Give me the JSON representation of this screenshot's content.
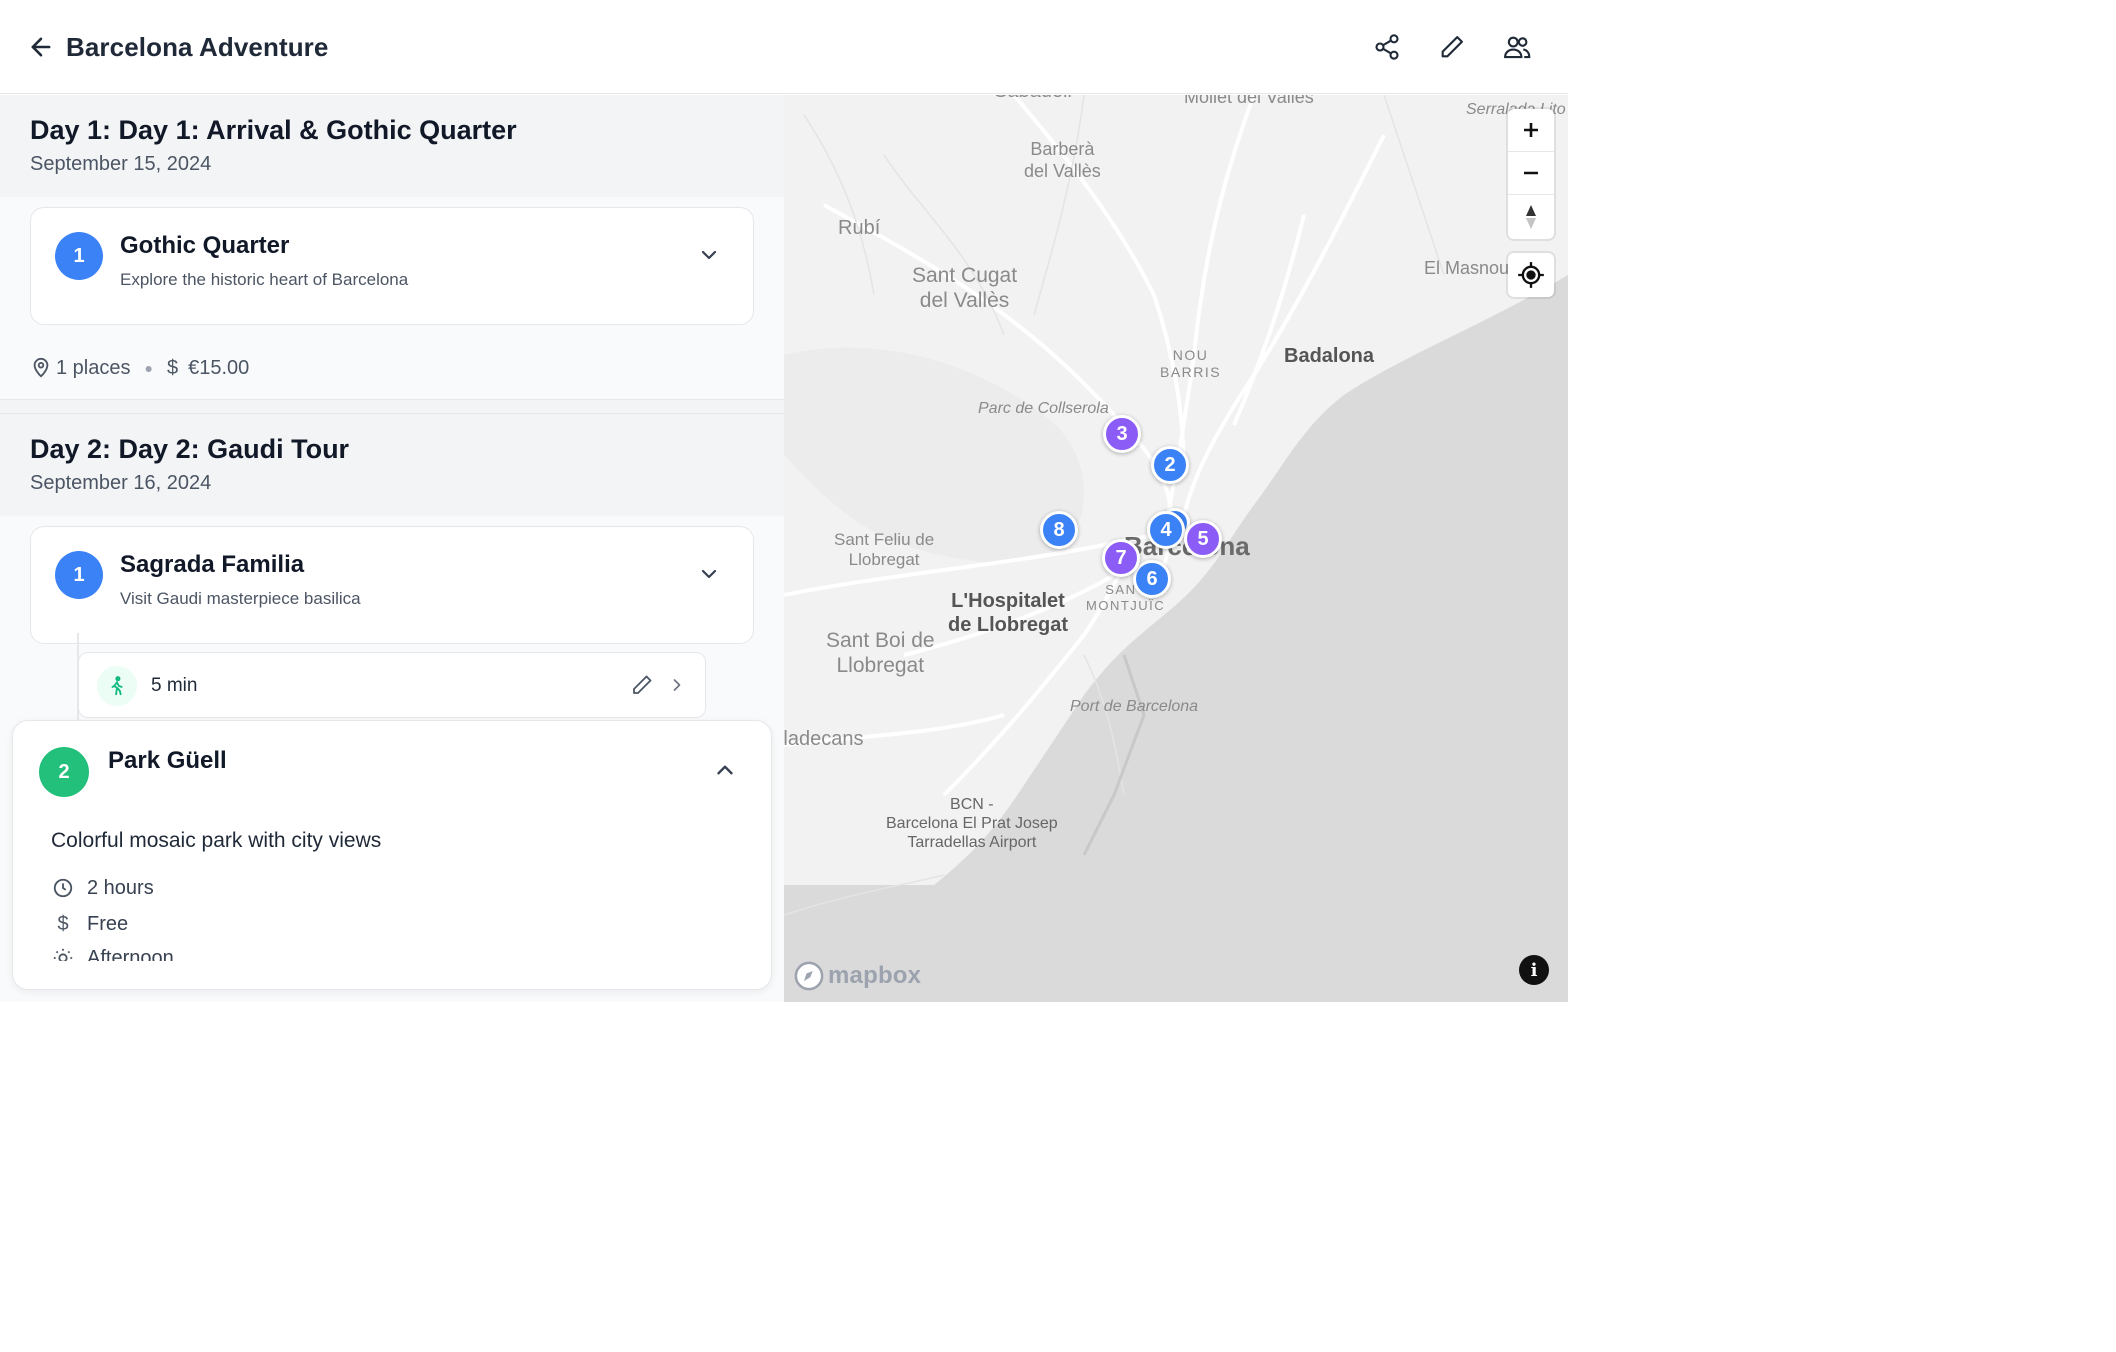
{
  "header": {
    "title": "Barcelona Adventure",
    "share_icon": "share-icon",
    "edit_icon": "pencil-icon",
    "collaborators_icon": "users-icon"
  },
  "days": [
    {
      "title": "Day 1: Day 1: Arrival & Gothic Quarter",
      "date": "September 15, 2024",
      "places": [
        {
          "number": "1",
          "name": "Gothic Quarter",
          "description": "Explore the historic heart of Barcelona"
        }
      ],
      "stats": {
        "places": "1 places",
        "cost": "€15.00"
      }
    },
    {
      "title": "Day 2: Day 2: Gaudi Tour",
      "date": "September 16, 2024",
      "places": [
        {
          "number": "1",
          "name": "Sagrada Familia",
          "description": "Visit Gaudi masterpiece basilica"
        },
        {
          "number": "2",
          "name": "Park Güell",
          "description": "Colorful mosaic park with city views",
          "duration": "2 hours",
          "price": "Free",
          "time_of_day": "Afternoon"
        }
      ],
      "travel": {
        "mode_icon": "walking-icon",
        "duration": "5 min"
      }
    }
  ],
  "map": {
    "labels": {
      "sabadell": "Sabadell",
      "mollet": "Mollet del Vallès",
      "serralada": "Serralada Lito",
      "barbera": "Barberà\ndel Vallès",
      "rubi": "Rubí",
      "sant_cugat": "Sant Cugat\ndel Vallès",
      "el_masnou": "El Masnou",
      "nou_barris": "NOU\nBARRIS",
      "badalona": "Badalona",
      "collserola": "Parc de Collserola",
      "sant_feliu": "Sant Feliu de\nLlobregat",
      "barcelona": "Barcelona",
      "hospitalet": "L'Hospitalet\nde Llobregat",
      "montjuic": "SANT\nMONTJUÏC",
      "sant_boi": "Sant Boi de\nLlobregat",
      "port": "Port de Barcelona",
      "viladecans": "Viladecans",
      "airport": "BCN -\nBarcelona El Prat Josep\nTarradellas Airport"
    },
    "markers": [
      "3",
      "2",
      "8",
      "4",
      "5",
      "7",
      "6"
    ],
    "marker_colors": {
      "blue": "#3b82f6",
      "purple": "#8b5cf6"
    },
    "attribution": "mapbox"
  }
}
